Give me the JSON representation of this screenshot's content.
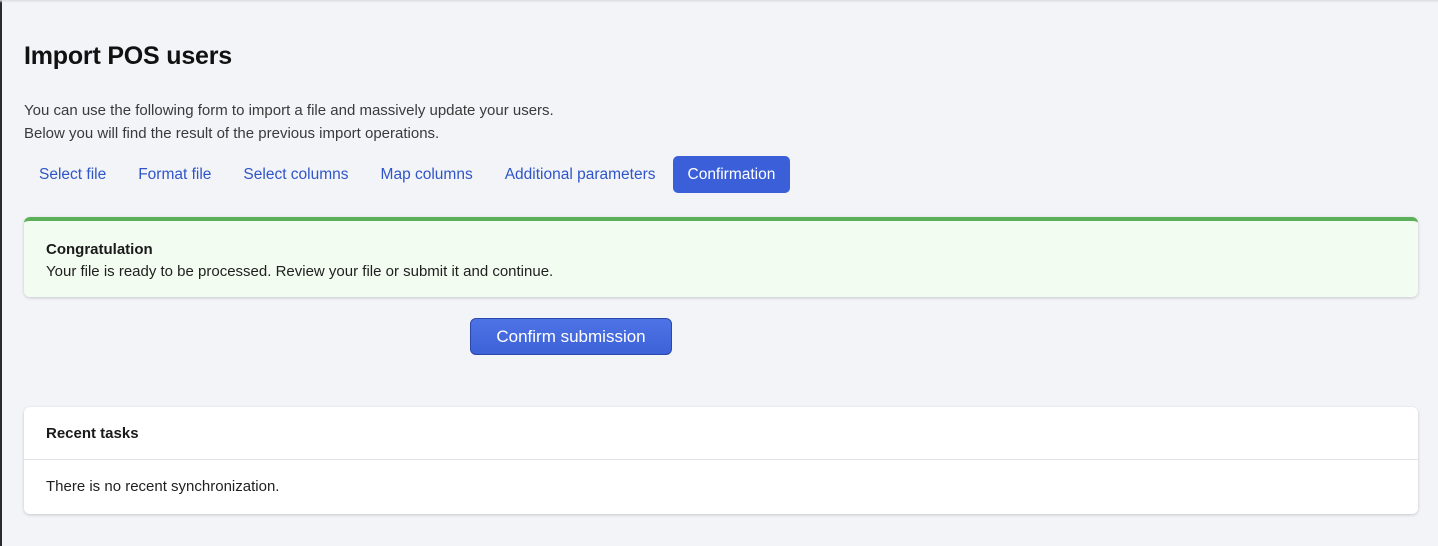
{
  "page": {
    "title": "Import POS users",
    "intro_line_1": "You can use the following form to import a file and massively update your users.",
    "intro_line_2": "Below you will find the result of the previous import operations."
  },
  "steps": [
    {
      "label": "Select file",
      "active": false
    },
    {
      "label": "Format file",
      "active": false
    },
    {
      "label": "Select columns",
      "active": false
    },
    {
      "label": "Map columns",
      "active": false
    },
    {
      "label": "Additional parameters",
      "active": false
    },
    {
      "label": "Confirmation",
      "active": true
    }
  ],
  "alert": {
    "title": "Congratulation",
    "message": "Your file is ready to be processed. Review your file or submit it and continue.",
    "accent_color": "#5cb05a"
  },
  "actions": {
    "confirm_label": "Confirm submission"
  },
  "recent_tasks": {
    "title": "Recent tasks",
    "empty_message": "There is no recent synchronization."
  },
  "colors": {
    "primary": "#3a5fd8",
    "link": "#2f55c8",
    "background": "#f3f4f8"
  }
}
